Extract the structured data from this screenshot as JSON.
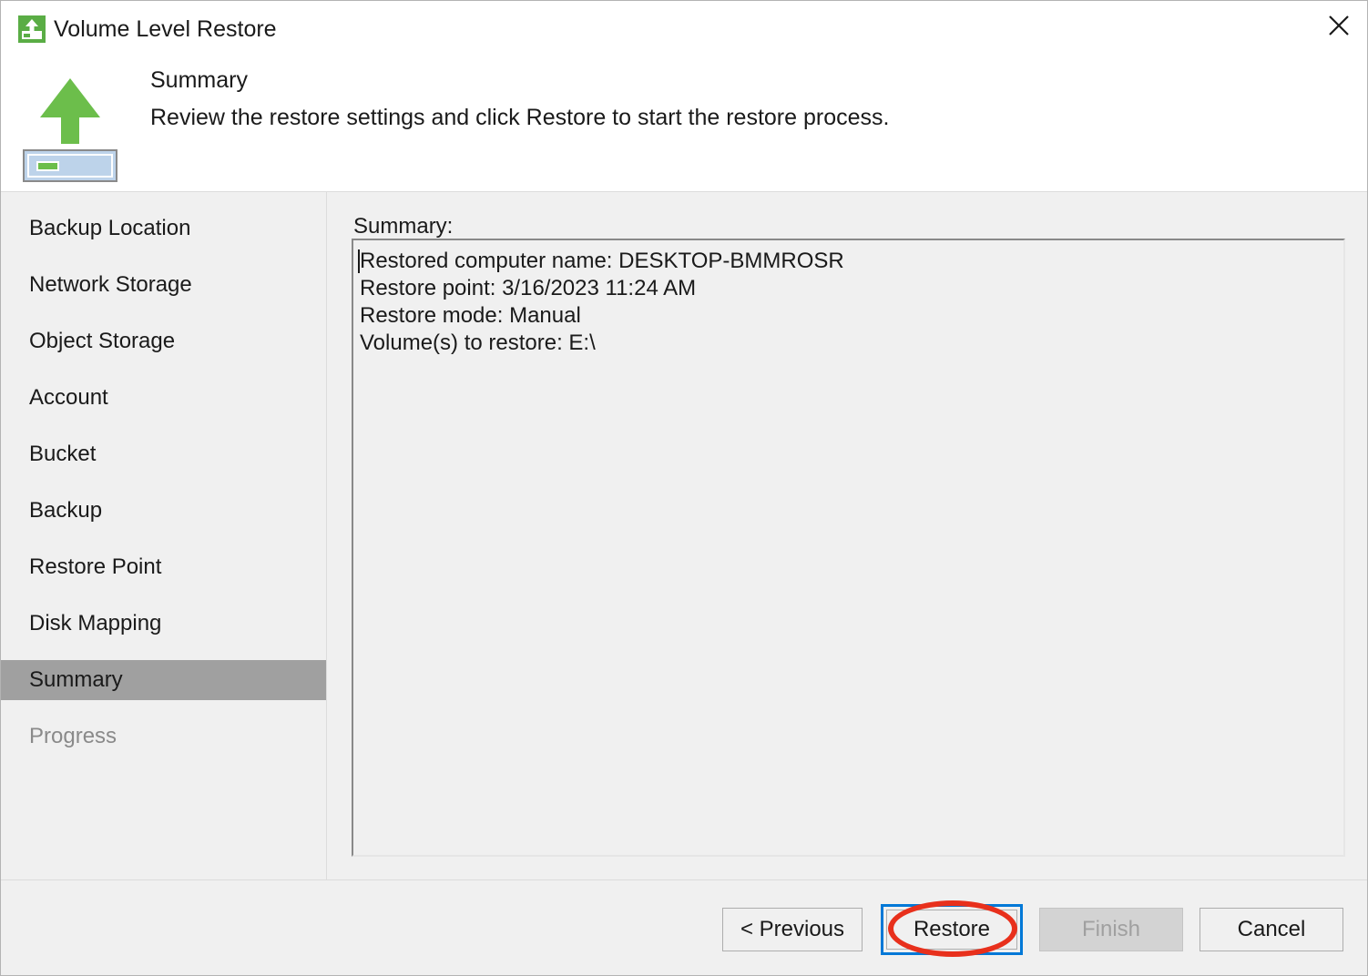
{
  "window": {
    "title": "Volume Level Restore",
    "icon": "volume-restore-icon",
    "close_label": "✕"
  },
  "header": {
    "title": "Summary",
    "subtitle": "Review the restore settings and click Restore to start the restore process.",
    "icon": "restore-arrow-drive-icon"
  },
  "sidebar": {
    "items": [
      {
        "label": "Backup Location",
        "state": "normal"
      },
      {
        "label": "Network Storage",
        "state": "normal"
      },
      {
        "label": "Object Storage",
        "state": "normal"
      },
      {
        "label": "Account",
        "state": "normal"
      },
      {
        "label": "Bucket",
        "state": "normal"
      },
      {
        "label": "Backup",
        "state": "normal"
      },
      {
        "label": "Restore Point",
        "state": "normal"
      },
      {
        "label": "Disk Mapping",
        "state": "normal"
      },
      {
        "label": "Summary",
        "state": "selected"
      },
      {
        "label": "Progress",
        "state": "disabled"
      }
    ]
  },
  "content": {
    "summary_label": "Summary:",
    "summary_lines": [
      "Restored computer name: DESKTOP-BMMROSR",
      "Restore point: 3/16/2023 11:24 AM",
      "Restore mode: Manual",
      "Volume(s) to restore: E:\\"
    ]
  },
  "footer": {
    "previous_label": "< Previous",
    "restore_label": "Restore",
    "finish_label": "Finish",
    "cancel_label": "Cancel"
  },
  "colors": {
    "accent_green": "#6cbe4b",
    "focus_blue": "#0078d7",
    "annotation_red": "#e8301c",
    "selection_gray": "#a0a0a0",
    "dialog_bg": "#f0f0f0"
  },
  "annotation": {
    "shape": "oval",
    "target": "restore-button"
  }
}
